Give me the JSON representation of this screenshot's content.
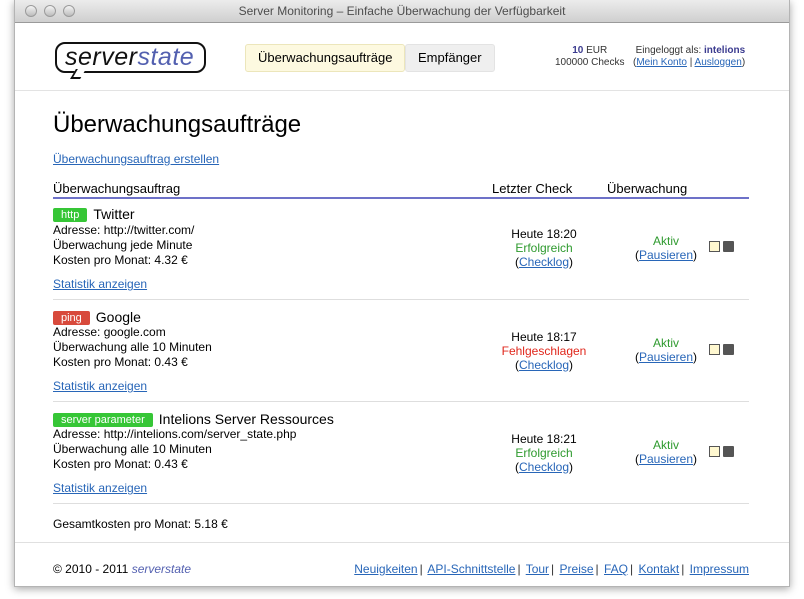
{
  "window": {
    "title": "Server Monitoring – Einfache Überwachung der Verfügbarkeit"
  },
  "logo": {
    "part1": "server",
    "part2": "state"
  },
  "tabs": [
    {
      "label": "Überwachungsaufträge",
      "active": true
    },
    {
      "label": "Empfänger",
      "active": false
    }
  ],
  "account": {
    "credit_amount": "10",
    "credit_unit": "EUR",
    "checks": "100000 Checks",
    "logged_in_label": "Eingeloggt als:",
    "username": "intelions",
    "my_account": "Mein Konto",
    "logout": "Ausloggen"
  },
  "page": {
    "title": "Überwachungsaufträge",
    "create_link": "Überwachungsauftrag erstellen",
    "columns": {
      "job": "Überwachungsauftrag",
      "last_check": "Letzter Check",
      "monitoring": "Überwachung"
    }
  },
  "jobs": [
    {
      "type": "http",
      "type_color": "#36c636",
      "name": "Twitter",
      "address": "Adresse: http://twitter.com/",
      "interval": "Überwachung jede Minute",
      "cost": "Kosten pro Monat: 4.32 €",
      "stats_link": "Statistik anzeigen",
      "last_check_time": "Heute 18:20",
      "last_check_status": "Erfolgreich",
      "checklog": "Checklog",
      "monitoring_status": "Aktiv",
      "pause": "Pausieren"
    },
    {
      "type": "ping",
      "type_color": "#d84a3c",
      "name": "Google",
      "address": "Adresse: google.com",
      "interval": "Überwachung alle 10 Minuten",
      "cost": "Kosten pro Monat: 0.43 €",
      "stats_link": "Statistik anzeigen",
      "last_check_time": "Heute 18:17",
      "last_check_status": "Fehlgeschlagen",
      "checklog": "Checklog",
      "monitoring_status": "Aktiv",
      "pause": "Pausieren"
    },
    {
      "type": "server parameter",
      "type_color": "#36c636",
      "name": "Intelions Server Ressources",
      "address": "Adresse: http://intelions.com/server_state.php",
      "interval": "Überwachung alle 10 Minuten",
      "cost": "Kosten pro Monat: 0.43 €",
      "stats_link": "Statistik anzeigen",
      "last_check_time": "Heute 18:21",
      "last_check_status": "Erfolgreich",
      "checklog": "Checklog",
      "monitoring_status": "Aktiv",
      "pause": "Pausieren"
    }
  ],
  "total_cost": "Gesamtkosten pro Monat: 5.18 €",
  "footer": {
    "copyright": "© 2010 - 2011",
    "brand_part1": "server",
    "brand_part2": "state",
    "links": [
      "Neuigkeiten",
      "API-Schnittstelle",
      "Tour",
      "Preise",
      "FAQ",
      "Kontakt",
      "Impressum"
    ]
  }
}
